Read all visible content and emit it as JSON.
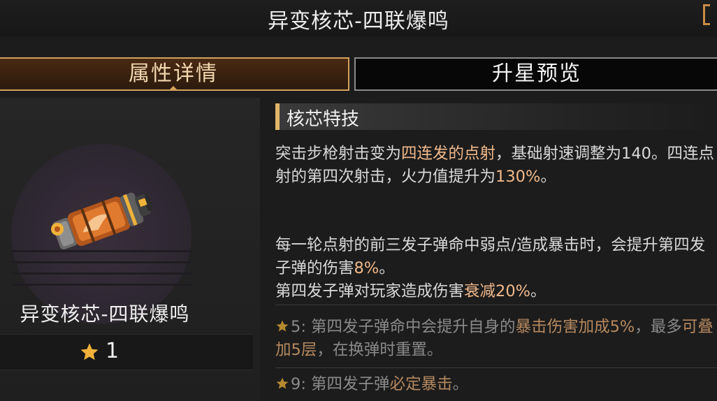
{
  "header": {
    "title": "异变核芯-四联爆鸣"
  },
  "tabs": [
    {
      "label": "属性详情",
      "active": true
    },
    {
      "label": "升星预览",
      "active": false
    }
  ],
  "item": {
    "name": "异变核芯-四联爆鸣",
    "star_count": "1",
    "icon": "barrel-core-icon"
  },
  "skill": {
    "section_title": "核芯特技",
    "p1": {
      "a": "突击步枪射击变为",
      "b": "四连发的点射",
      "c": "，基础射速调整为140。四连点射的第四次射击，火力值提升为",
      "d": "130%",
      "e": "。"
    },
    "p2": {
      "a": "每一轮点射的前三发子弹命中弱点/造成暴击时，会提升第四发子弹的伤害",
      "b": "8%",
      "c": "。"
    },
    "p3": {
      "a": "第四发子弹对玩家造成伤害",
      "b": "衰减20%",
      "c": "。"
    },
    "star5": {
      "a": "5: 第四发子弹命中会提升自身的",
      "b": "暴击伤害加成5%",
      "c": "，最多",
      "d": "可叠加5层",
      "e": "，在换弹时重置。"
    },
    "star9": {
      "a": "9: 第四发子弹",
      "b": "必定暴击",
      "c": "。"
    }
  },
  "colors": {
    "accent": "#d3a25e",
    "highlight": "#f1b98a",
    "star": "#f0b23a",
    "dim_text": "#8a8a8a"
  }
}
